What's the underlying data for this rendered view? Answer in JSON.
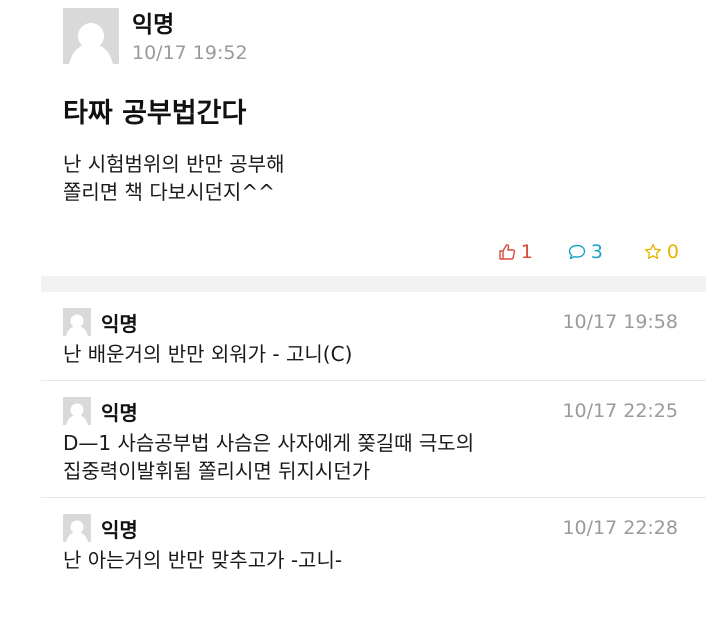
{
  "post": {
    "author": "익명",
    "time": "10/17 19:52",
    "title": "타짜 공부법간다",
    "body_lines": [
      "난 시험범위의 반만 공부해",
      "쫄리면 책 다보시던지^^"
    ],
    "likes": "1",
    "comments": "3",
    "scraps": "0",
    "icons": {
      "like": "thumbs-up-icon",
      "comment": "speech-bubble-icon",
      "scrap": "star-icon"
    }
  },
  "colors": {
    "like": "#d84a3a",
    "comment": "#1aa3c5",
    "scrap": "#e6b400",
    "time": "#9a9a9a",
    "avatar_bg": "#d9d9d9"
  },
  "comments": [
    {
      "author": "익명",
      "time": "10/17 19:58",
      "lines": [
        "난 배운거의 반만 외워가 - 고니(C)"
      ]
    },
    {
      "author": "익명",
      "time": "10/17 22:25",
      "lines": [
        "D—1 사슴공부법 사슴은 사자에게 쫒길때 극도의",
        "집중력이발휘됨 쫄리시면 뒤지시던가"
      ]
    },
    {
      "author": "익명",
      "time": "10/17 22:28",
      "lines": [
        "난 아는거의 반만 맞추고가 -고니-"
      ]
    }
  ]
}
